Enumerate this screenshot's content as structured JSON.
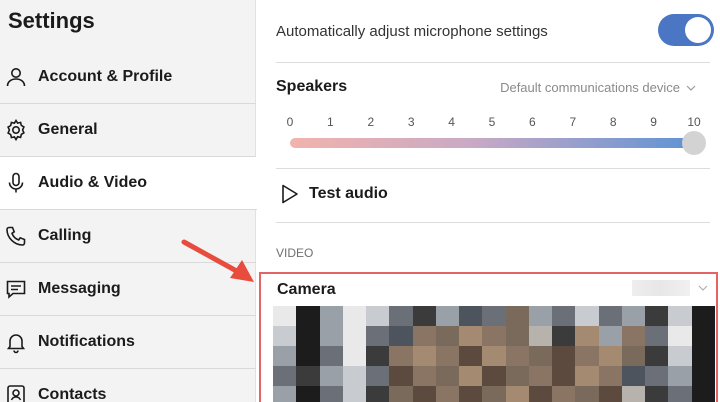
{
  "sidebar": {
    "title": "Settings",
    "items": [
      {
        "label": "Account & Profile",
        "icon": "person-icon"
      },
      {
        "label": "General",
        "icon": "gear-icon"
      },
      {
        "label": "Audio & Video",
        "icon": "microphone-icon",
        "active": true
      },
      {
        "label": "Calling",
        "icon": "phone-icon"
      },
      {
        "label": "Messaging",
        "icon": "message-icon"
      },
      {
        "label": "Notifications",
        "icon": "bell-icon"
      },
      {
        "label": "Contacts",
        "icon": "contacts-icon"
      }
    ]
  },
  "main": {
    "auto_mic_label": "Automatically adjust microphone settings",
    "auto_mic_on": true,
    "speakers": {
      "title": "Speakers",
      "device": "Default communications device",
      "ticks": [
        "0",
        "1",
        "2",
        "3",
        "4",
        "5",
        "6",
        "7",
        "8",
        "9",
        "10"
      ],
      "volume": 10
    },
    "test_audio_label": "Test audio",
    "video_section": "VIDEO",
    "camera": {
      "title": "Camera"
    }
  },
  "colors": {
    "toggle_on": "#4a76c4",
    "highlight_border": "#e26464",
    "arrow": "#e84c3d",
    "slider_start": "#f1b3ad",
    "slider_end": "#5f93d4"
  }
}
